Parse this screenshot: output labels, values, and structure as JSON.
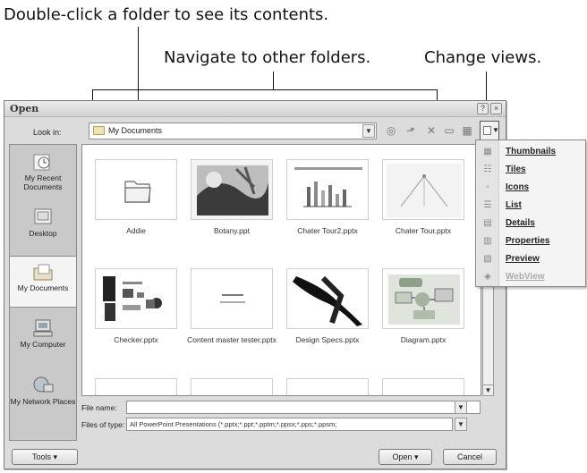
{
  "callouts": {
    "double_click": "Double-click a folder to see its contents.",
    "navigate": "Navigate to other folders.",
    "change_views": "Change views."
  },
  "dialog": {
    "title": "Open",
    "look_in_label": "Look in:",
    "look_in_value": "My Documents",
    "places": [
      {
        "label": "My Recent Documents"
      },
      {
        "label": "Desktop"
      },
      {
        "label": "My Documents"
      },
      {
        "label": "My Computer"
      },
      {
        "label": "My Network Places"
      }
    ],
    "files": [
      {
        "name": "Addie"
      },
      {
        "name": "Botany.ppt"
      },
      {
        "name": "Chater Tour2.pptx"
      },
      {
        "name": "Chater Tour.pptx"
      },
      {
        "name": "Checker.pptx"
      },
      {
        "name": "Content master tester.pptx"
      },
      {
        "name": "Design Specs.pptx"
      },
      {
        "name": "Diagram.pptx"
      }
    ],
    "file_name_label": "File name:",
    "file_name_value": "",
    "files_of_type_label": "Files of type:",
    "files_of_type_value": "All PowerPoint Presentations (*.pptx;*.ppt;*.pptm;*.ppsx;*.pps;*.ppsm;",
    "tools_label": "Tools",
    "open_label": "Open",
    "cancel_label": "Cancel"
  },
  "views_menu": {
    "items": [
      {
        "label": "Thumbnails",
        "icon": "thumbnails-icon",
        "enabled": true
      },
      {
        "label": "Tiles",
        "icon": "tiles-icon",
        "enabled": true
      },
      {
        "label": "Icons",
        "icon": "icons-icon",
        "enabled": true
      },
      {
        "label": "List",
        "icon": "list-icon",
        "enabled": true
      },
      {
        "label": "Details",
        "icon": "details-icon",
        "enabled": true
      },
      {
        "label": "Properties",
        "icon": "properties-icon",
        "enabled": true
      },
      {
        "label": "Preview",
        "icon": "preview-icon",
        "enabled": true
      },
      {
        "label": "WebView",
        "icon": "webview-icon",
        "enabled": false
      }
    ]
  }
}
